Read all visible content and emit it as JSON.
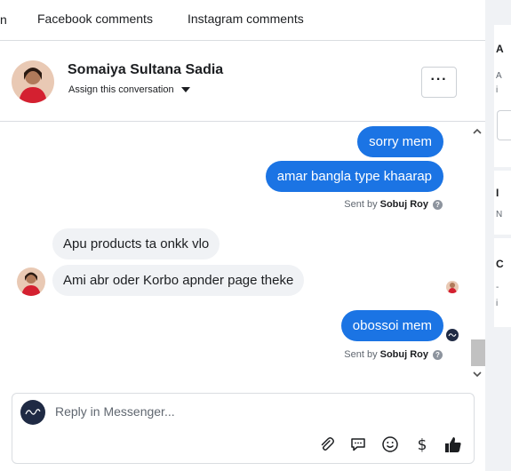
{
  "tabs": {
    "partial_label": "n",
    "facebook": "Facebook comments",
    "instagram": "Instagram comments"
  },
  "contact": {
    "name": "Somaiya Sultana Sadia",
    "assign_label": "Assign this conversation",
    "more_label": "···"
  },
  "messages": {
    "out1": "sorry mem",
    "out2": "amar bangla type khaarap",
    "sent_by_prefix": "Sent by",
    "sent_by_name": "Sobuj Roy",
    "in1": "Apu products ta onkk vlo",
    "in2": "Ami abr oder Korbo apnder page theke",
    "out3": "obossoi mem"
  },
  "reply": {
    "placeholder": "Reply in Messenger..."
  },
  "right_panel": {
    "t1": "A",
    "s1": "A",
    "s1b": "i",
    "t2": "I",
    "s2": "N",
    "t3": "C",
    "s3": "-",
    "s3b": "i"
  },
  "icons": {
    "more": "more-icon",
    "caret": "caret-down-icon",
    "attach": "paperclip-icon",
    "saved_replies": "chat-bubble-icon",
    "emoji": "smiley-icon",
    "payment": "dollar-icon",
    "like": "thumbs-up-icon"
  },
  "colors": {
    "outgoing_bubble": "#1b74e4",
    "incoming_bubble": "#f0f2f5",
    "brand_avatar": "#1f2a44"
  }
}
